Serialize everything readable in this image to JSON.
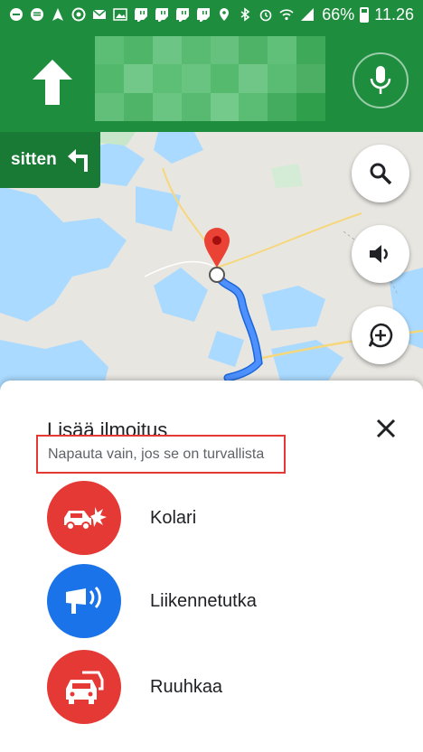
{
  "status_bar": {
    "battery": "66%",
    "time": "11.26",
    "icons": [
      "minus-circle-icon",
      "email-icon",
      "navigation-icon",
      "headset-icon",
      "mail-icon",
      "image-icon",
      "twitch-icon",
      "twitch-icon",
      "twitch-icon",
      "twitch-icon",
      "location-icon",
      "bluetooth-icon",
      "alarm-icon",
      "wifi-icon",
      "signal-icon",
      "battery-icon"
    ]
  },
  "nav_header": {
    "maneuver_icon": "straight-arrow-icon",
    "street_name": "",
    "mic_icon": "microphone-icon",
    "then_label": "sitten",
    "then_icon": "turn-left-icon"
  },
  "map_controls": {
    "search_icon": "search-icon",
    "sound_icon": "volume-icon",
    "report_icon": "add-report-icon"
  },
  "report_sheet": {
    "title": "Lisää ilmoitus",
    "subtitle": "Napauta vain, jos se on turvallista",
    "close_icon": "close-icon",
    "items": [
      {
        "label": "Kolari",
        "icon": "crash-icon",
        "color": "#e53935"
      },
      {
        "label": "Liikennetutka",
        "icon": "speed-camera-icon",
        "color": "#1a73e8"
      },
      {
        "label": "Ruuhkaa",
        "icon": "traffic-jam-icon",
        "color": "#e53935"
      }
    ]
  },
  "colors": {
    "nav_green": "#1e8e3e",
    "then_green": "#187a34",
    "route_blue": "#4285f4",
    "highlight_red": "#e53935"
  }
}
